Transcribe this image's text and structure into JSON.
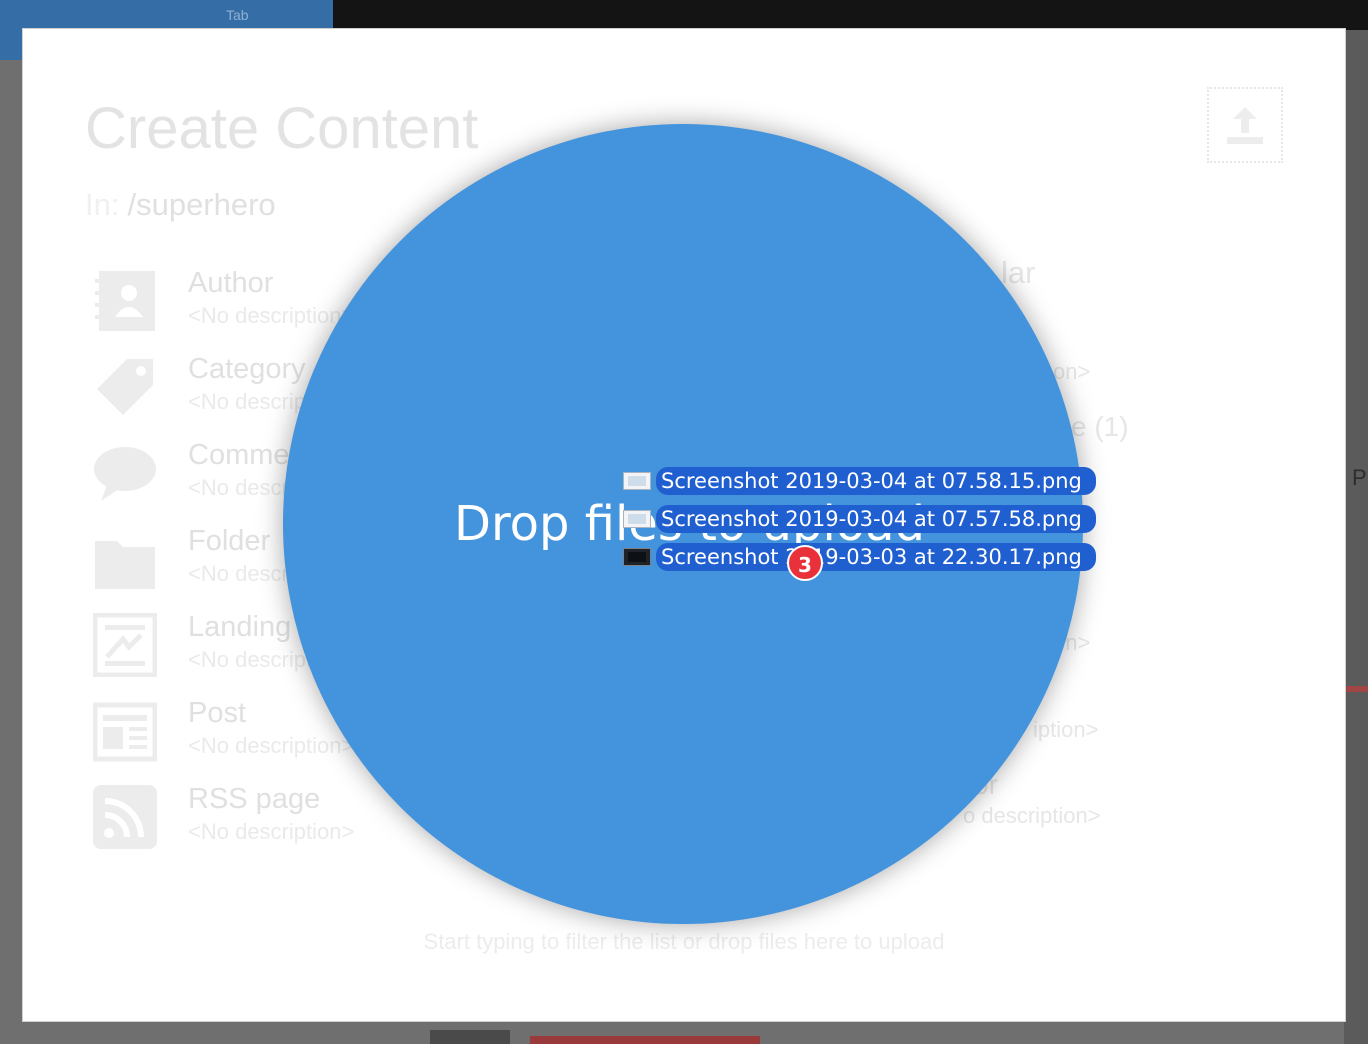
{
  "background": {
    "tab_label": "Tab",
    "right_glyph": "P"
  },
  "modal": {
    "title": "Create Content",
    "path_prefix": "In:",
    "path": "/superhero",
    "upload_icon": "upload-icon",
    "content_types": [
      {
        "name": "Author",
        "description": "<No description>",
        "icon": "author-icon"
      },
      {
        "name": "Category",
        "description": "<No description>",
        "icon": "tag-icon"
      },
      {
        "name": "Comment",
        "description": "<No description>",
        "icon": "comment-icon"
      },
      {
        "name": "Folder",
        "description": "<No description>",
        "icon": "folder-icon"
      },
      {
        "name": "Landing",
        "description": "<No description>",
        "icon": "landing-page-icon"
      },
      {
        "name": "Post",
        "description": "<No description>",
        "icon": "post-icon"
      },
      {
        "name": "RSS page",
        "description": "<No description>",
        "icon": "rss-icon"
      }
    ],
    "right_column_fragments": [
      "lar",
      "on>",
      "e (1)",
      "on>",
      "iption>",
      "or",
      "o description>"
    ],
    "hint": "Start typing to filter the list or drop files here to upload"
  },
  "drop_zone": {
    "label": "Drop files to upload",
    "color": "#4493dd"
  },
  "dragged_files": {
    "count": "3",
    "files": [
      {
        "name": "Screenshot 2019-03-04 at 07.58.15.png",
        "thumb": "light"
      },
      {
        "name": "Screenshot 2019-03-04 at 07.57.58.png",
        "thumb": "light"
      },
      {
        "name": "Screenshot 2019-03-03 at 22.30.17.png",
        "thumb": "dark"
      }
    ]
  }
}
